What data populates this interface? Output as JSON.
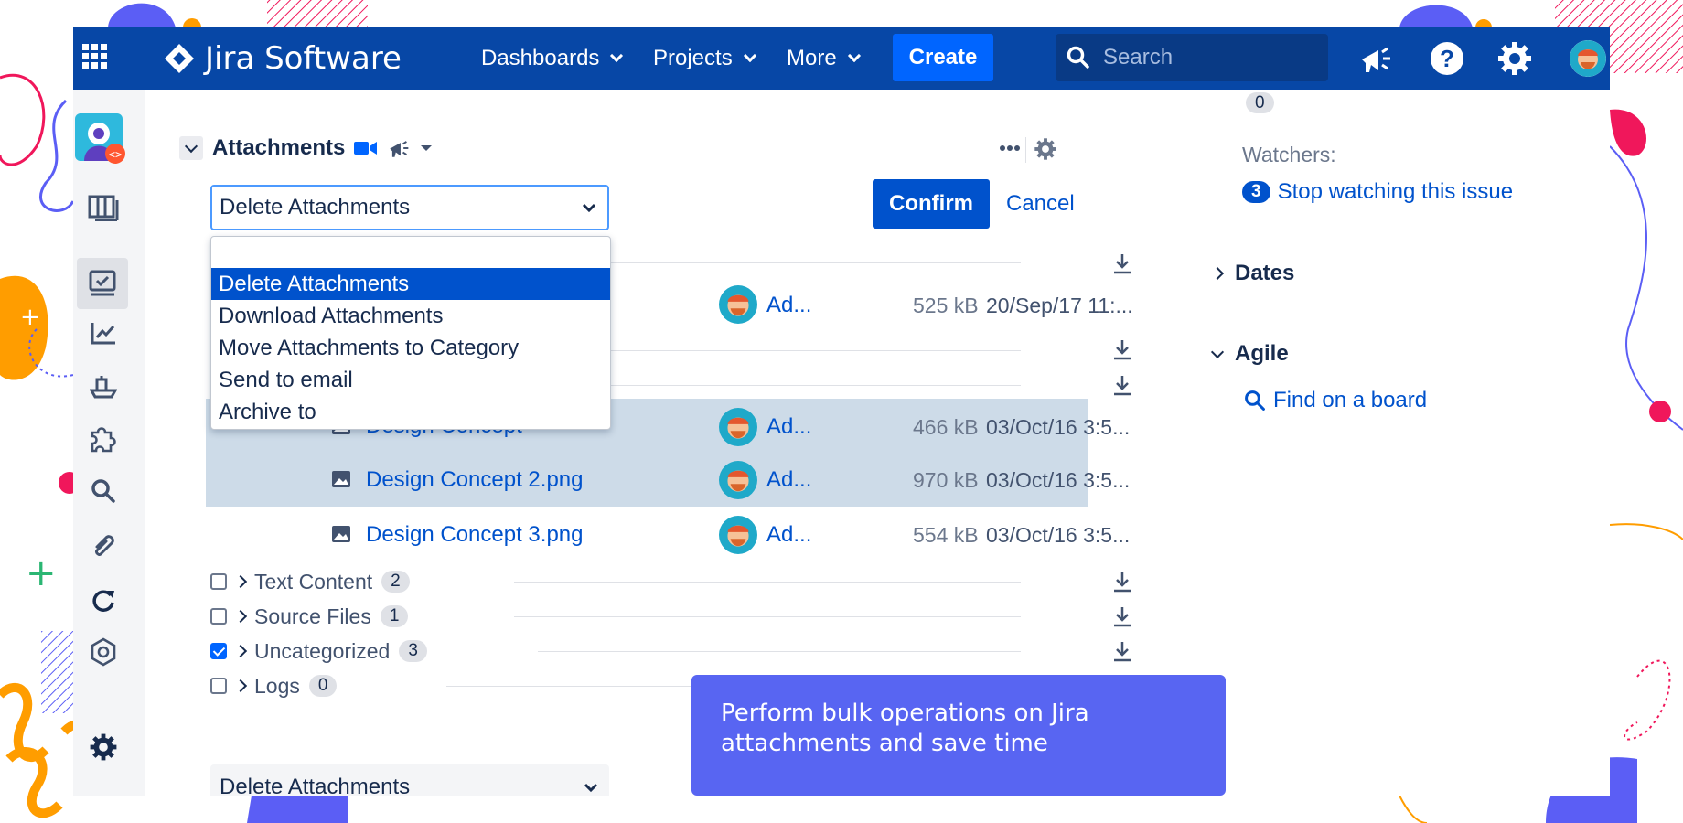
{
  "colors": {
    "topbar": "#0747a6",
    "create_button": "#0065ff",
    "primary": "#0052cc",
    "selection": "#0052cc",
    "highlight_rows": "#cddbe8",
    "tooltip": "#5865f2",
    "deco_pink": "#f0175b",
    "deco_orange": "#ff9d00",
    "deco_blue": "#5b5ef5"
  },
  "topbar": {
    "brand": "Jira Software",
    "nav": [
      {
        "label": "Dashboards"
      },
      {
        "label": "Projects"
      },
      {
        "label": "More"
      }
    ],
    "create": "Create",
    "search_placeholder": "Search",
    "icons": [
      "app-switcher-icon",
      "megaphone-icon",
      "help-icon",
      "settings-icon",
      "user-avatar"
    ]
  },
  "sidebar": {
    "icons": [
      "project-avatar",
      "board-icon",
      "backlog-icon",
      "reports-icon",
      "releases-icon",
      "apps-icon",
      "search-icon",
      "attachments-icon",
      "sync-icon",
      "components-icon",
      "settings-icon"
    ]
  },
  "attachments": {
    "title": "Attachments",
    "action_select": "Delete Attachments",
    "confirm": "Confirm",
    "cancel": "Cancel",
    "dropdown_options": [
      "Delete Attachments",
      "Download Attachments",
      "Move Attachments to Category",
      "Send to email",
      "Archive to"
    ],
    "selected_option": "Delete Attachments",
    "hidden_row": {
      "author": "Ad...",
      "size": "525 kB",
      "date": "20/Sep/17 11:..."
    },
    "files": [
      {
        "name": "Design Concept",
        "author": "Ad...",
        "size": "466 kB",
        "date": "03/Oct/16 3:5...",
        "selected": true
      },
      {
        "name": "Design Concept 2.png",
        "author": "Ad...",
        "size": "970 kB",
        "date": "03/Oct/16 3:5...",
        "selected": true
      },
      {
        "name": "Design Concept 3.png",
        "author": "Ad...",
        "size": "554 kB",
        "date": "03/Oct/16 3:5...",
        "selected": false
      }
    ],
    "categories": [
      {
        "name": "Text Content",
        "count": "2",
        "checked": false
      },
      {
        "name": "Source Files",
        "count": "1",
        "checked": false
      },
      {
        "name": "Uncategorized",
        "count": "3",
        "checked": true
      },
      {
        "name": "Logs",
        "count": "0",
        "checked": false
      }
    ],
    "bottom_select": "Delete Attachments"
  },
  "right_panel": {
    "top_badge": "0",
    "watchers_label": "Watchers:",
    "watchers_count": "3",
    "watch_link": "Stop watching this issue",
    "dates": "Dates",
    "agile": "Agile",
    "find_on_board": "Find on a board"
  },
  "tooltip": "Perform bulk operations on Jira attachments and save time"
}
